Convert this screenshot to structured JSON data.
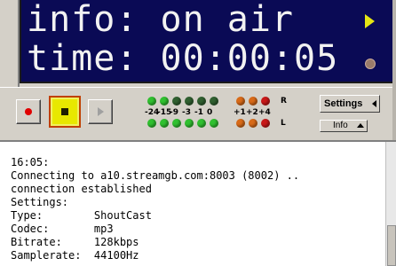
{
  "display": {
    "line1": "info: on air",
    "line2": "time: 00:00:05",
    "play_icon": "play-triangle-icon",
    "dot_icon": "record-dot-icon"
  },
  "controls": {
    "record_icon": "record-icon",
    "stop_icon": "stop-icon",
    "play_icon": "play-icon",
    "settings_label": "Settings",
    "info_label": "Info"
  },
  "vu": {
    "scale": [
      "-24",
      "-15",
      "-9",
      "-3",
      "-1",
      "0",
      "+1",
      "+2",
      "+4"
    ],
    "right_label": "R",
    "left_label": "L",
    "colors": {
      "green": "#30c030",
      "dark_green": "#306030",
      "orange": "#d86a18",
      "red": "#c81818"
    }
  },
  "log": {
    "lines": [
      "16:05:",
      "Connecting to a10.streamgb.com:8003 (8002) ..",
      "connection established",
      "Settings:",
      "Type:        ShoutCast",
      "Codec:       mp3",
      "Bitrate:     128kbps",
      "Samplerate:  44100Hz"
    ]
  }
}
